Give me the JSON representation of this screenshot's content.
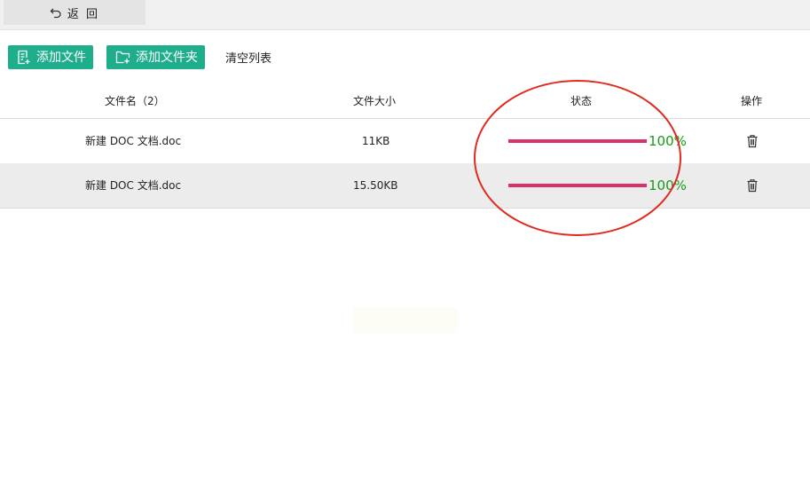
{
  "topbar": {
    "back_label": "返 回"
  },
  "toolbar": {
    "add_file_label": "添加文件",
    "add_folder_label": "添加文件夹",
    "clear_list_label": "清空列表"
  },
  "table": {
    "headers": {
      "name": "文件名（2）",
      "size": "文件大小",
      "status": "状态",
      "action": "操作"
    },
    "rows": [
      {
        "name": "新建 DOC 文档.doc",
        "size": "11KB",
        "progress": 100,
        "percent_label": "100%"
      },
      {
        "name": "新建 DOC 文档.doc",
        "size": "15.50KB",
        "progress": 100,
        "percent_label": "100%"
      }
    ]
  },
  "colors": {
    "accent": "#1fae8c",
    "progress_bar": "#d9326a",
    "percent_text": "#1a9a1a",
    "annotation_circle": "#e02a1e"
  },
  "icons": {
    "back": "back-arrow-icon",
    "add_file": "file-add-icon",
    "add_folder": "folder-add-icon",
    "delete": "trash-icon"
  }
}
